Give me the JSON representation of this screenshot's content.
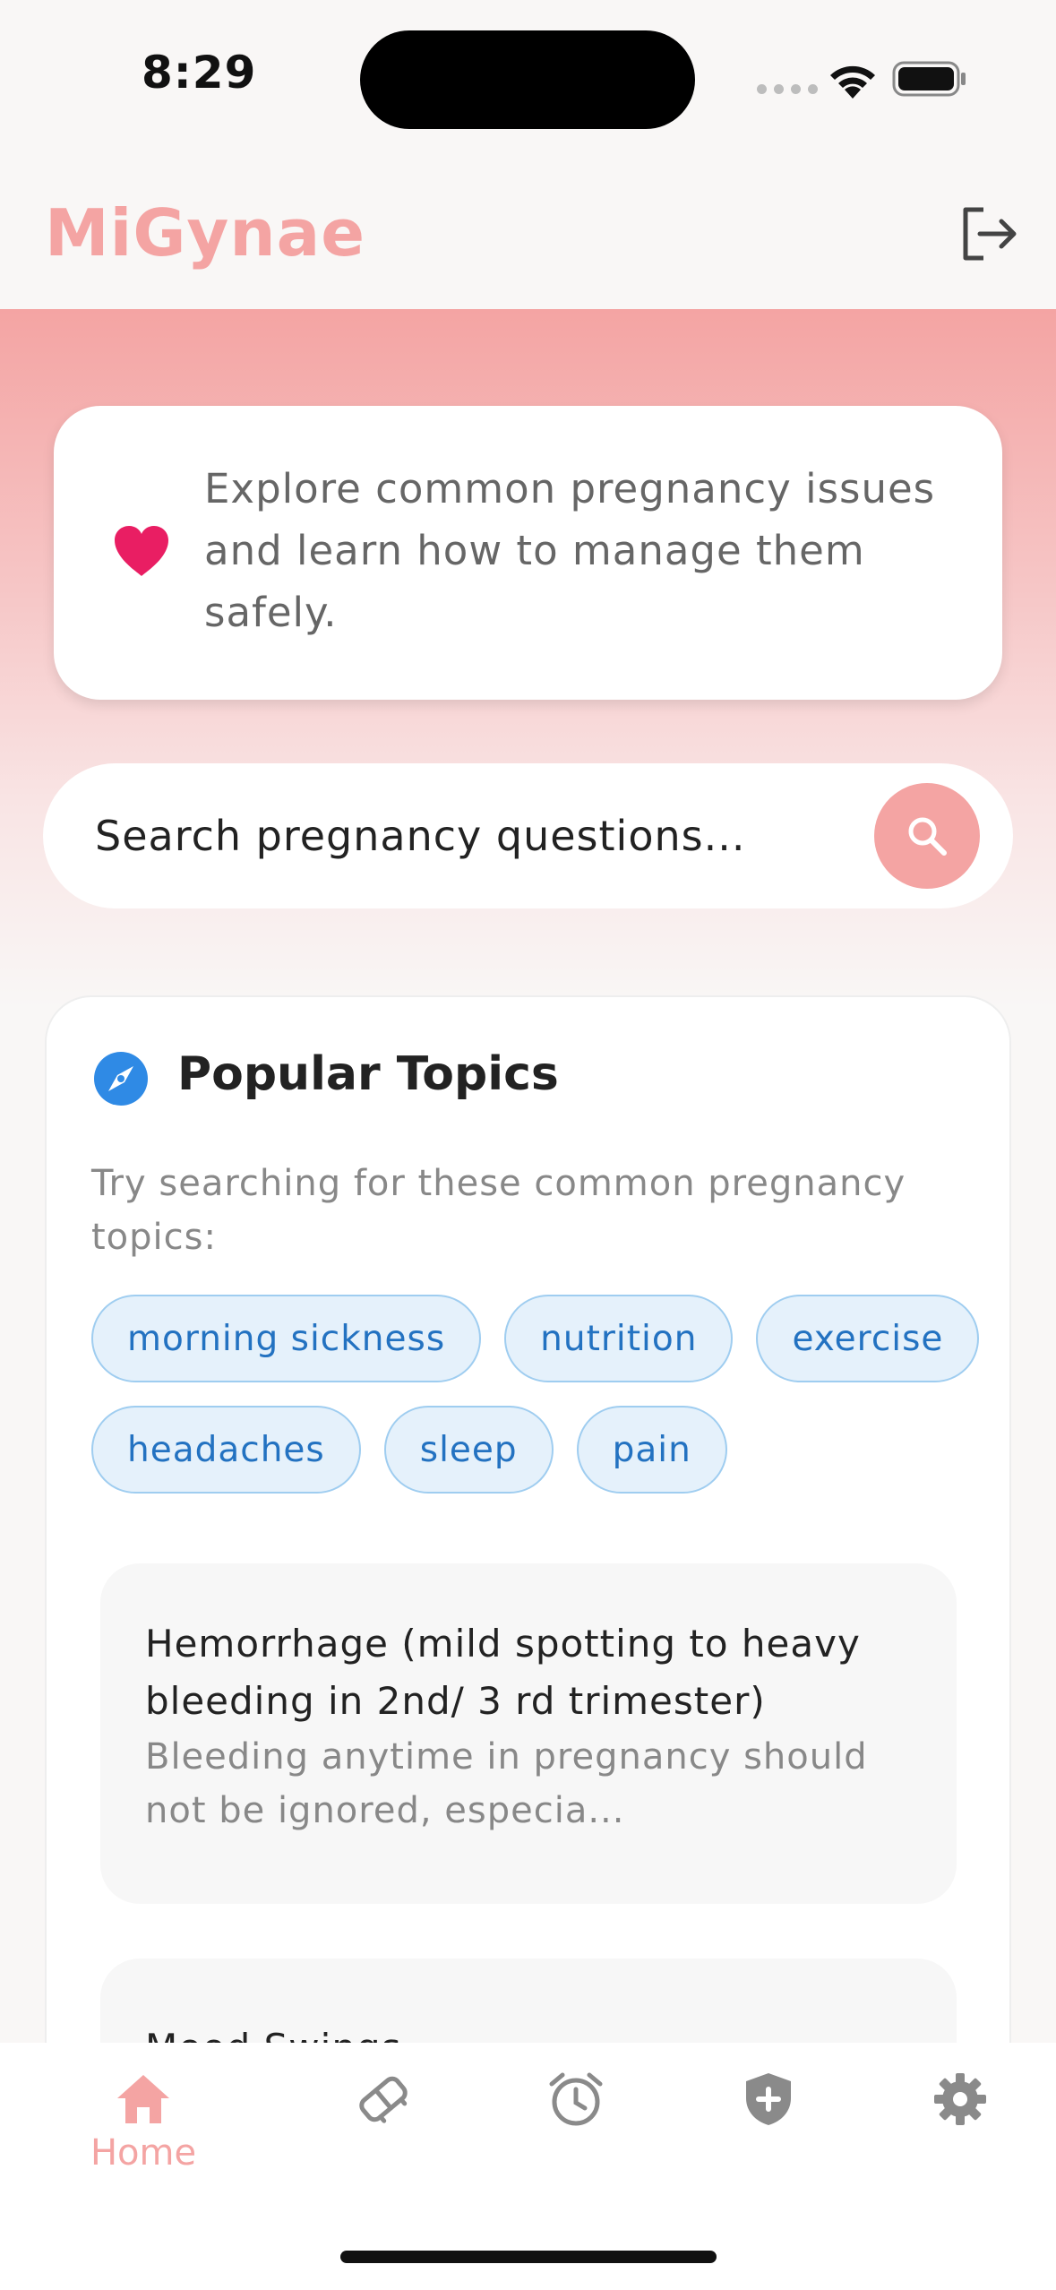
{
  "status_bar": {
    "time": "8:29"
  },
  "app_bar": {
    "title": "MiGynae",
    "logout_icon": "logout-icon"
  },
  "info_card": {
    "icon": "heart-icon",
    "text": "Explore common pregnancy issues and learn how to manage them safely."
  },
  "search": {
    "placeholder": "Search pregnancy questions...",
    "value": ""
  },
  "topics": {
    "title": "Popular Topics",
    "subtitle": "Try searching for these common pregnancy topics:",
    "chips": [
      "morning sickness",
      "nutrition",
      "exercise",
      "headaches",
      "sleep",
      "pain"
    ]
  },
  "issues": [
    {
      "title": "Hemorrhage (mild spotting to heavy bleeding in 2nd/ 3 rd trimester)",
      "summary": "Bleeding anytime in pregnancy should not be ignored, especia..."
    },
    {
      "title": "Mood Swings",
      "summary": ""
    }
  ],
  "bottom_nav": {
    "items": [
      {
        "label": "Home",
        "icon": "home-icon",
        "active": true
      },
      {
        "label": "",
        "icon": "care-hands-icon",
        "active": false
      },
      {
        "label": "",
        "icon": "alarm-icon",
        "active": false
      },
      {
        "label": "",
        "icon": "shield-icon",
        "active": false
      },
      {
        "label": "",
        "icon": "gear-icon",
        "active": false
      }
    ]
  },
  "colors": {
    "brand_pink": "#f4a4a3",
    "heart_red": "#e91e63",
    "chip_blue": "#2372c1",
    "chip_bg": "#e5f1fb",
    "compass_blue": "#2f8ae5",
    "icon_grey": "#8a8a8a"
  }
}
